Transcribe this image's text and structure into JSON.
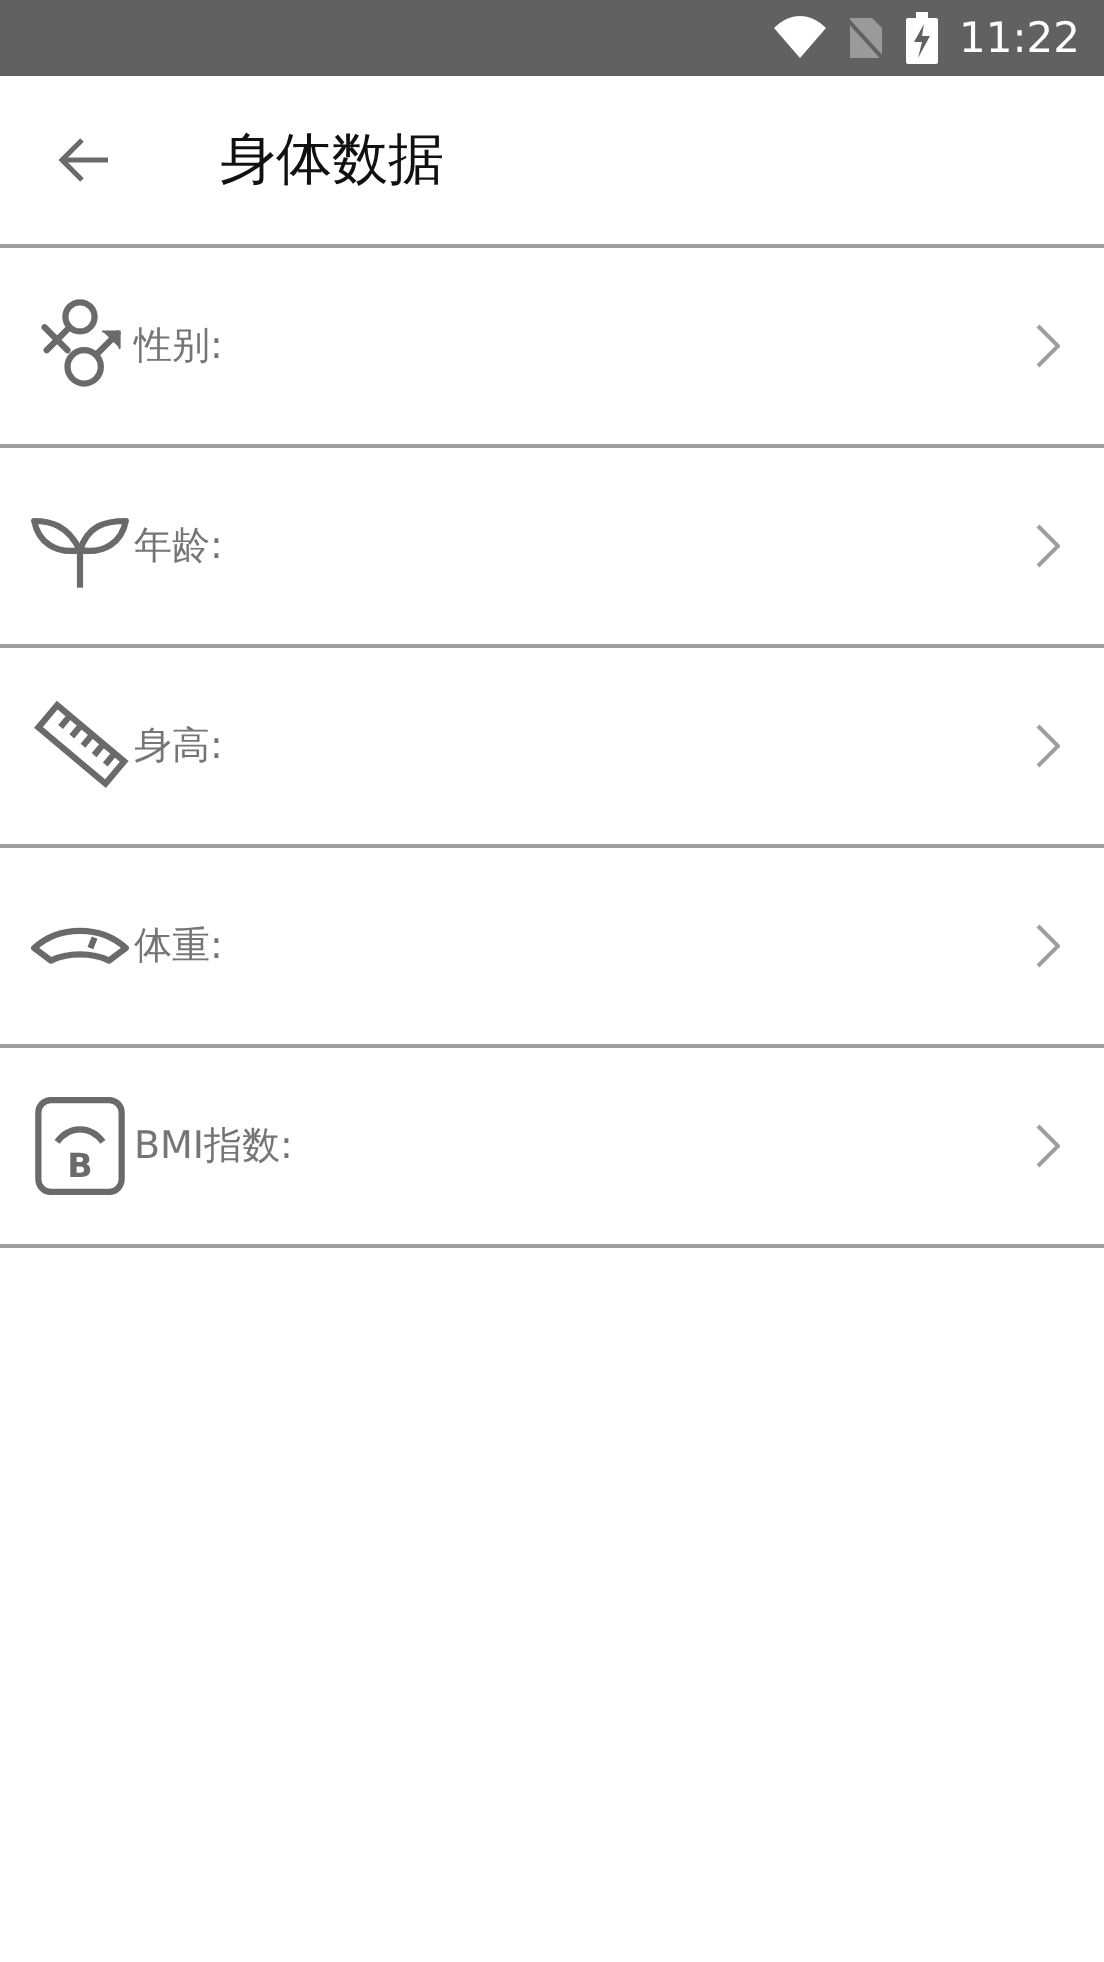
{
  "status_bar": {
    "time": "11:22"
  },
  "header": {
    "title": "身体数据"
  },
  "items": [
    {
      "kind": "gender",
      "label": "性别:"
    },
    {
      "kind": "age",
      "label": "年龄:"
    },
    {
      "kind": "height",
      "label": "身高:"
    },
    {
      "kind": "weight",
      "label": "体重:"
    },
    {
      "kind": "bmi",
      "label": "BMI指数:",
      "icon_letter": "B"
    }
  ]
}
